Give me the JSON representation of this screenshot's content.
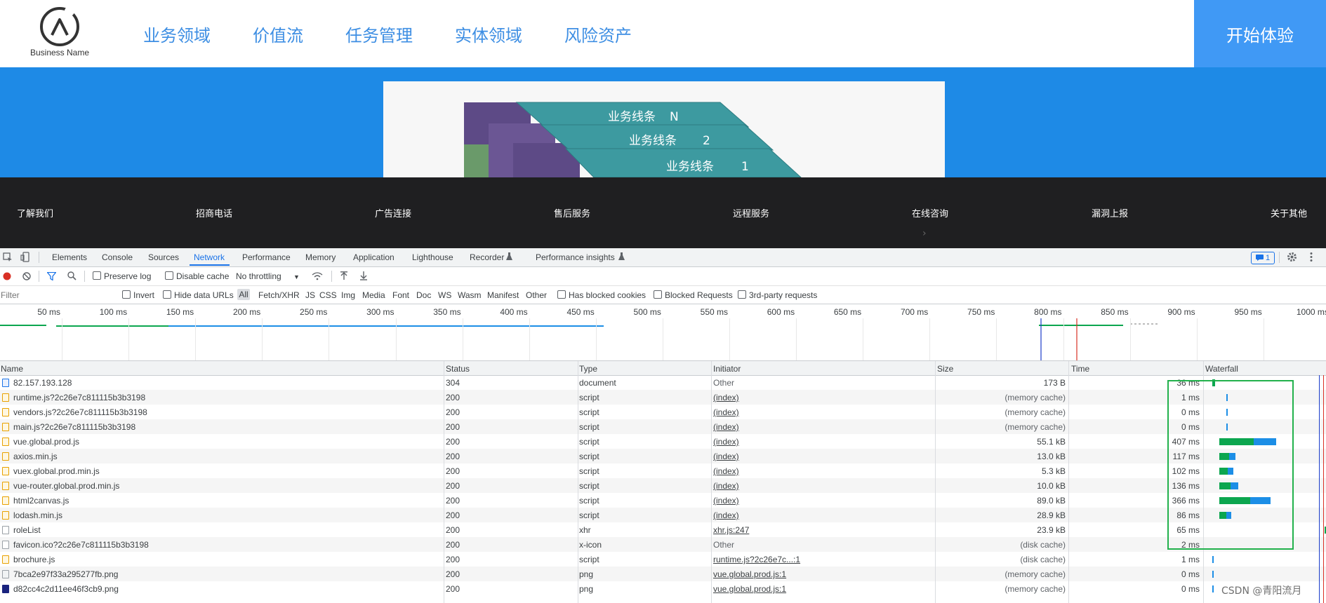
{
  "header": {
    "logo_text": "Business Name",
    "nav": [
      "业务领域",
      "价值流",
      "任务管理",
      "实体领域",
      "风险资产"
    ],
    "cta_label": "开始体验"
  },
  "banner": {
    "lanes": [
      "业务线条",
      "业务线条",
      "业务线条"
    ],
    "lane_numbers": [
      "N",
      "2",
      "1"
    ]
  },
  "footer": {
    "links": [
      "了解我们",
      "招商电话",
      "广告连接",
      "售后服务",
      "远程服务",
      "在线咨询",
      "漏洞上报",
      "关于其他"
    ],
    "chevron": "›"
  },
  "devtools": {
    "tabs": [
      "Elements",
      "Console",
      "Sources",
      "Network",
      "Performance",
      "Memory",
      "Application",
      "Lighthouse",
      "Recorder",
      "Performance insights"
    ],
    "active_tab": "Network",
    "issues_badge": "1",
    "toolbar": {
      "preserve_log": "Preserve log",
      "disable_cache": "Disable cache",
      "throttling": "No throttling"
    },
    "filterbar": {
      "placeholder": "Filter",
      "invert": "Invert",
      "hide_data_urls": "Hide data URLs",
      "types": [
        "All",
        "Fetch/XHR",
        "JS",
        "CSS",
        "Img",
        "Media",
        "Font",
        "Doc",
        "WS",
        "Wasm",
        "Manifest",
        "Other"
      ],
      "has_blocked_cookies": "Has blocked cookies",
      "blocked_requests": "Blocked Requests",
      "third_party": "3rd-party requests"
    },
    "timeline_ticks": [
      "50 ms",
      "100 ms",
      "150 ms",
      "200 ms",
      "250 ms",
      "300 ms",
      "350 ms",
      "400 ms",
      "450 ms",
      "500 ms",
      "550 ms",
      "600 ms",
      "650 ms",
      "700 ms",
      "750 ms",
      "800 ms",
      "850 ms",
      "900 ms",
      "950 ms",
      "1000 ms"
    ],
    "columns": {
      "name": "Name",
      "status": "Status",
      "type": "Type",
      "initiator": "Initiator",
      "size": "Size",
      "time": "Time",
      "waterfall": "Waterfall"
    },
    "rows": [
      {
        "name": "82.157.193.128",
        "status": "304",
        "type": "document",
        "initiator": "Other",
        "size": "173 B",
        "time": "36 ms",
        "icon": "document-icon"
      },
      {
        "name": "runtime.js?2c26e7c811115b3b3198",
        "status": "200",
        "type": "script",
        "initiator": "(index)",
        "size": "(memory cache)",
        "time": "1 ms",
        "icon": "script-icon"
      },
      {
        "name": "vendors.js?2c26e7c811115b3b3198",
        "status": "200",
        "type": "script",
        "initiator": "(index)",
        "size": "(memory cache)",
        "time": "0 ms",
        "icon": "script-icon"
      },
      {
        "name": "main.js?2c26e7c811115b3b3198",
        "status": "200",
        "type": "script",
        "initiator": "(index)",
        "size": "(memory cache)",
        "time": "0 ms",
        "icon": "script-icon"
      },
      {
        "name": "vue.global.prod.js",
        "status": "200",
        "type": "script",
        "initiator": "(index)",
        "size": "55.1 kB",
        "time": "407 ms",
        "icon": "script-icon"
      },
      {
        "name": "axios.min.js",
        "status": "200",
        "type": "script",
        "initiator": "(index)",
        "size": "13.0 kB",
        "time": "117 ms",
        "icon": "script-icon"
      },
      {
        "name": "vuex.global.prod.min.js",
        "status": "200",
        "type": "script",
        "initiator": "(index)",
        "size": "5.3 kB",
        "time": "102 ms",
        "icon": "script-icon"
      },
      {
        "name": "vue-router.global.prod.min.js",
        "status": "200",
        "type": "script",
        "initiator": "(index)",
        "size": "10.0 kB",
        "time": "136 ms",
        "icon": "script-icon"
      },
      {
        "name": "html2canvas.js",
        "status": "200",
        "type": "script",
        "initiator": "(index)",
        "size": "89.0 kB",
        "time": "366 ms",
        "icon": "script-icon"
      },
      {
        "name": "lodash.min.js",
        "status": "200",
        "type": "script",
        "initiator": "(index)",
        "size": "28.9 kB",
        "time": "86 ms",
        "icon": "script-icon"
      },
      {
        "name": "roleList",
        "status": "200",
        "type": "xhr",
        "initiator": "xhr.js:247",
        "size": "23.9 kB",
        "time": "65 ms",
        "icon": "xhr-icon"
      },
      {
        "name": "favicon.ico?2c26e7c811115b3b3198",
        "status": "200",
        "type": "x-icon",
        "initiator": "Other",
        "size": "(disk cache)",
        "time": "2 ms",
        "icon": "file-icon"
      },
      {
        "name": "brochure.js",
        "status": "200",
        "type": "script",
        "initiator": "runtime.js?2c26e7c...:1",
        "size": "(disk cache)",
        "time": "1 ms",
        "icon": "script-icon"
      },
      {
        "name": "7bca2e97f33a295277fb.png",
        "status": "200",
        "type": "png",
        "initiator": "vue.global.prod.js:1",
        "size": "(memory cache)",
        "time": "0 ms",
        "icon": "image-icon"
      },
      {
        "name": "d82cc4c2d11ee46f3cb9.png",
        "status": "200",
        "type": "png",
        "initiator": "vue.global.prod.js:1",
        "size": "(memory cache)",
        "time": "0 ms",
        "icon": "image-icon"
      }
    ]
  },
  "watermark": "CSDN @青阳流月",
  "colors": {
    "nav_blue": "#3d8ee3",
    "cta_blue": "#4099f5",
    "banner_blue": "#1e8ae6",
    "footer_bg": "#1f1f21",
    "waiting_green": "#0ca64f",
    "download_blue": "#1c8ee6",
    "highlight_green": "#22b14c"
  }
}
